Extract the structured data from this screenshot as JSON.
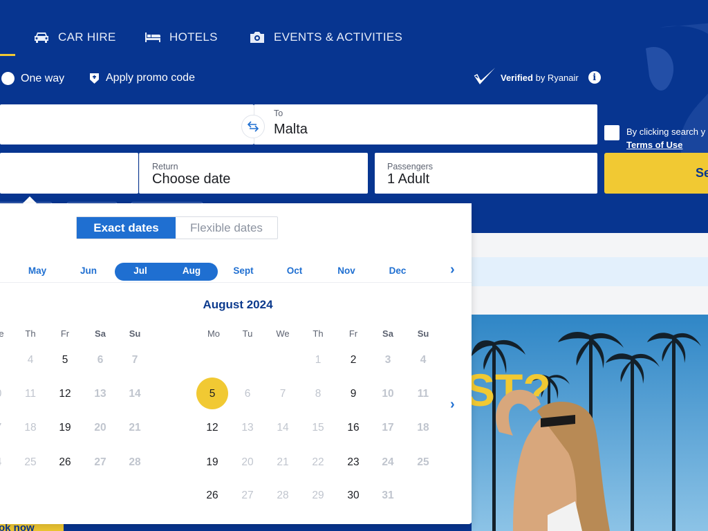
{
  "nav": {
    "items": [
      {
        "label": "CAR HIRE",
        "icon": "car-icon"
      },
      {
        "label": "HOTELS",
        "icon": "bed-icon"
      },
      {
        "label": "EVENTS & ACTIVITIES",
        "icon": "camera-icon"
      }
    ]
  },
  "options": {
    "one_way": "One way",
    "promo": "Apply promo code"
  },
  "verified": {
    "bold": "Verified",
    "rest": "by Ryanair"
  },
  "form": {
    "to_label": "To",
    "to_value": "Malta",
    "return_label": "Return",
    "return_value": "Choose date",
    "passengers_label": "Passengers",
    "passengers_value": "1 Adult",
    "terms_text": "By clicking search y",
    "terms_link": "Terms of Use",
    "search_label": "Se"
  },
  "calendar": {
    "toggle_exact": "Exact dates",
    "toggle_flexible": "Flexible dates",
    "months": [
      "May",
      "Jun",
      "Jul",
      "Aug",
      "Sept",
      "Oct",
      "Nov",
      "Dec"
    ],
    "selected_months": [
      "Jul",
      "Aug"
    ],
    "title_right": "August 2024",
    "weekdays": [
      "Mo",
      "Tu",
      "We",
      "Th",
      "Fr",
      "Sa",
      "Su"
    ],
    "left_partial_weekday": "e",
    "left_rows": [
      {
        "partial": "",
        "th": "4",
        "fr": "5",
        "sa": "6",
        "su": "7"
      },
      {
        "partial": "0",
        "th": "11",
        "fr": "12",
        "sa": "13",
        "su": "14"
      },
      {
        "partial": "7",
        "th": "18",
        "fr": "19",
        "sa": "20",
        "su": "21"
      },
      {
        "partial": "4",
        "th": "25",
        "fr": "26",
        "sa": "27",
        "su": "28"
      }
    ],
    "right_rows": [
      [
        "",
        "",
        "",
        "1",
        "2",
        "3",
        "4"
      ],
      [
        "5",
        "6",
        "7",
        "8",
        "9",
        "10",
        "11"
      ],
      [
        "12",
        "13",
        "14",
        "15",
        "16",
        "17",
        "18"
      ],
      [
        "19",
        "20",
        "21",
        "22",
        "23",
        "24",
        "25"
      ],
      [
        "26",
        "27",
        "28",
        "29",
        "30",
        "31",
        ""
      ]
    ],
    "selected_day": "5"
  },
  "colors": {
    "brand_blue": "#073590",
    "accent_yellow": "#f1c933",
    "link_blue": "#1f6fd1"
  },
  "banner": {
    "text": "ST?"
  },
  "bottom": {
    "text": "ok now"
  }
}
